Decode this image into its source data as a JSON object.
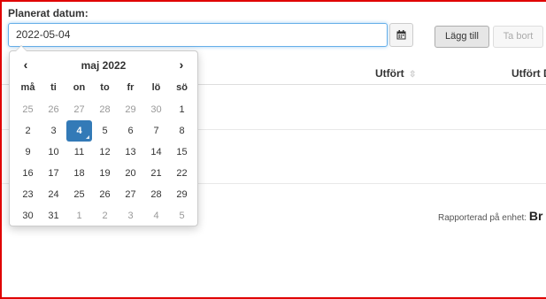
{
  "form": {
    "label": "Planerat datum:",
    "date_value": "2022-05-04",
    "add_label": "Lägg till",
    "remove_label": "Ta bort"
  },
  "table": {
    "col_utfort": "Utfört",
    "col_utfort_datum": "Utfört D"
  },
  "reported": {
    "prefix": "Rapporterad på enhet:",
    "unit": "Br"
  },
  "datepicker": {
    "prev": "‹",
    "next": "›",
    "title": "maj 2022",
    "weekdays": [
      "må",
      "ti",
      "on",
      "to",
      "fr",
      "lö",
      "sö"
    ],
    "weeks": [
      [
        "25",
        "26",
        "27",
        "28",
        "29",
        "30",
        "1"
      ],
      [
        "2",
        "3",
        "4",
        "5",
        "6",
        "7",
        "8"
      ],
      [
        "9",
        "10",
        "11",
        "12",
        "13",
        "14",
        "15"
      ],
      [
        "16",
        "17",
        "18",
        "19",
        "20",
        "21",
        "22"
      ],
      [
        "23",
        "24",
        "25",
        "26",
        "27",
        "28",
        "29"
      ],
      [
        "30",
        "31",
        "1",
        "2",
        "3",
        "4",
        "5"
      ]
    ],
    "selected": "4"
  },
  "icons": {
    "calendar_button": "calendar-icon",
    "sort": "sort-icon"
  },
  "colors": {
    "accent": "#337ab7",
    "frame": "#e00000",
    "focus": "#66afe9"
  }
}
